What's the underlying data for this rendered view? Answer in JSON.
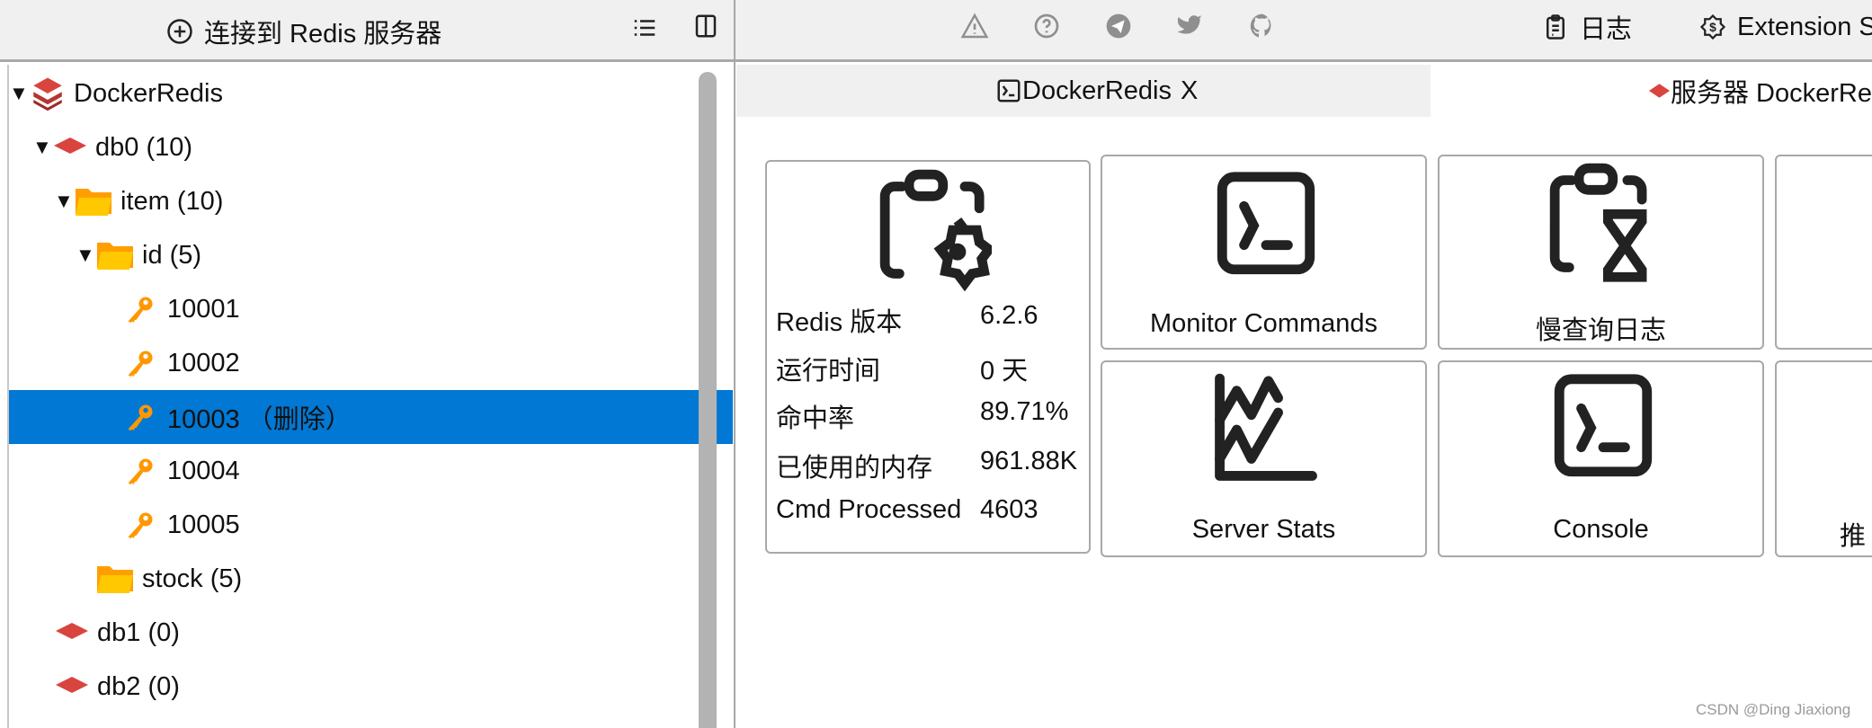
{
  "sidebar_header": {
    "connect_label": "连接到 Redis 服务器",
    "icons": [
      "plus-circle-icon",
      "list-icon",
      "split-view-icon"
    ]
  },
  "toolbar": {
    "icons": [
      "warning-icon",
      "help-icon",
      "telegram-icon",
      "twitter-icon",
      "github-icon"
    ],
    "log_label": "日志",
    "extension_label": "Extension S"
  },
  "tree": {
    "server": "DockerRedis",
    "items": [
      {
        "label": "db0  (10)"
      },
      {
        "label": "item (10)"
      },
      {
        "label": "id (5)"
      },
      {
        "label": "10001"
      },
      {
        "label": "10002"
      },
      {
        "label": "10003 （删除）",
        "selected": true
      },
      {
        "label": "10004"
      },
      {
        "label": "10005"
      },
      {
        "label": "stock (5)"
      },
      {
        "label": "db1  (0)"
      },
      {
        "label": "db2  (0)"
      }
    ]
  },
  "tabs": [
    {
      "label": "DockerRedis",
      "close": "X"
    },
    {
      "label": "服务器 DockerRe"
    }
  ],
  "server_info": {
    "rows": [
      {
        "label": "Redis 版本",
        "value": "6.2.6"
      },
      {
        "label": "运行时间",
        "value": "0 天"
      },
      {
        "label": "命中率",
        "value": "89.71%"
      },
      {
        "label": "已使用的内存",
        "value": "961.88K"
      },
      {
        "label": "Cmd Processed",
        "value": "4603"
      }
    ]
  },
  "cards": [
    {
      "label": "Monitor Commands"
    },
    {
      "label": "慢查询日志"
    },
    {
      "label": "Server Stats"
    },
    {
      "label": "Console"
    },
    {
      "label": "推"
    }
  ],
  "colors": {
    "selection": "#0078d4",
    "redis_red": "#d9443f",
    "folder": "#ffc800",
    "key": "#ff9800"
  },
  "watermark": "CSDN @Ding Jiaxiong"
}
